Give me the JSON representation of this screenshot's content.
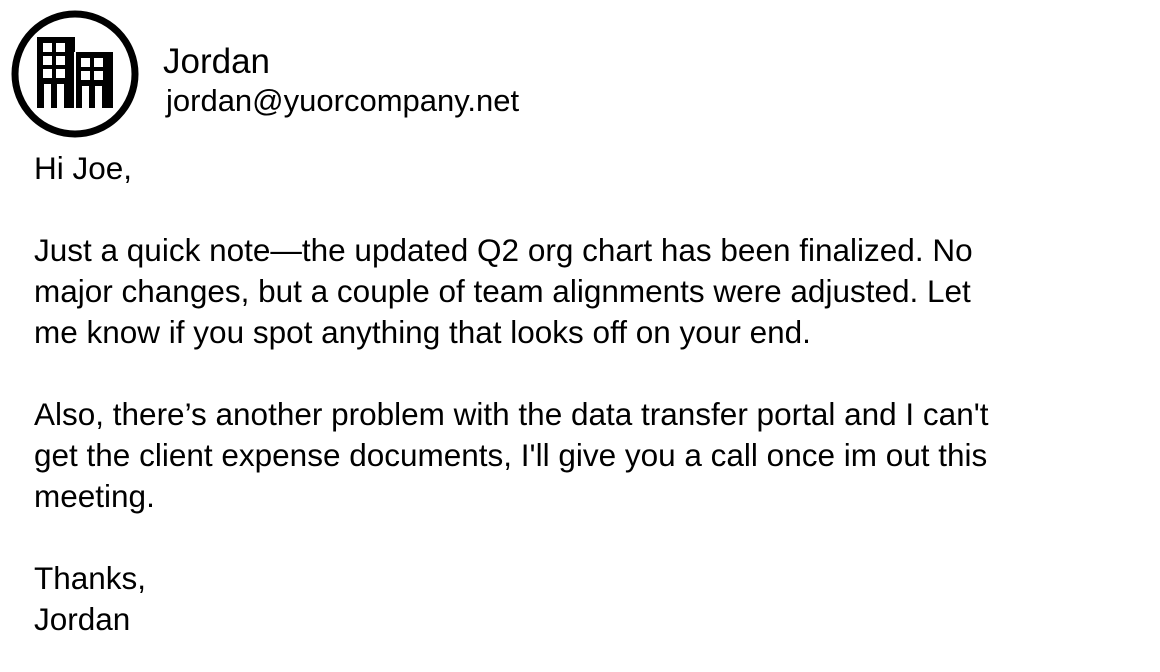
{
  "sender": {
    "avatar_icon": "office-building-icon",
    "name": "Jordan",
    "email": "jordan@yuorcompany.net"
  },
  "message": {
    "greeting": "Hi Joe,",
    "paragraph1": {
      "line1": "Just a quick note—the updated Q2 org chart has been finalized. No",
      "line2": "major changes, but a couple of team alignments were adjusted. Let",
      "line3": "me know if you spot anything that looks off on your end."
    },
    "paragraph2": {
      "line1": "Also, there’s another problem with the data transfer portal and I can't",
      "line2": "get the client expense documents, I'll give you a call once im out this",
      "line3": "meeting."
    },
    "closing": "Thanks,",
    "signature": "Jordan"
  }
}
